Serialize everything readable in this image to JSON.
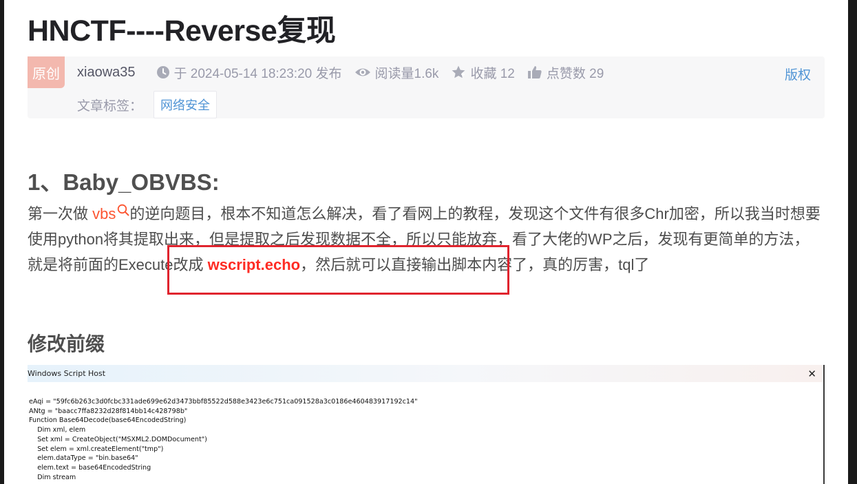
{
  "article": {
    "title": "HNCTF----Reverse复现",
    "badge": "原创",
    "author": "xiaowa35",
    "published": "于 2024-05-14 18:23:20 发布",
    "reads": "阅读量1.6k",
    "favorites": "收藏 12",
    "likes": "点赞数 29",
    "copyright": "版权",
    "tags_label": "文章标签：",
    "tags": [
      "网络安全"
    ]
  },
  "section1": {
    "heading": "1、Baby_OBVBS:",
    "p_part1": "第一次做 ",
    "p_link": "vbs",
    "p_part2": "的逆向题目，根本不知道怎么解决，看了看网上的教程，发现这个文件有很多Chr加密，所以我当时想要使用python将其提取出来，但是提取之后发现数据不全，所以只能放弃，看了大佬的WP之后，发现有更简单的方法，就是将前面的Execute改成 ",
    "p_strong": "wscript.echo",
    "p_part3": "，然后就可以直接输出脚本内容了，真的厉害，tql了"
  },
  "section2": {
    "heading": "修改前缀"
  },
  "screenshot": {
    "window_title": "Windows Script Host",
    "close_glyph": "✕",
    "lines": [
      "eAqi = \"59fc6b263c3d0fcbc331ade699e62d3473bbf85522d588e3423e6c751ca091528a3c0186e460483917192c14\"",
      "ANtg = \"baacc7ffa8232d28f814bb14c428798b\"",
      "Function Base64Decode(base64EncodedString)",
      "    Dim xml, elem",
      "    Set xml = CreateObject(\"MSXML2.DOMDocument\")",
      "    Set elem = xml.createElement(\"tmp\")",
      "    elem.dataType = \"bin.base64\"",
      "    elem.text = base64EncodedString",
      "    Dim stream"
    ]
  }
}
